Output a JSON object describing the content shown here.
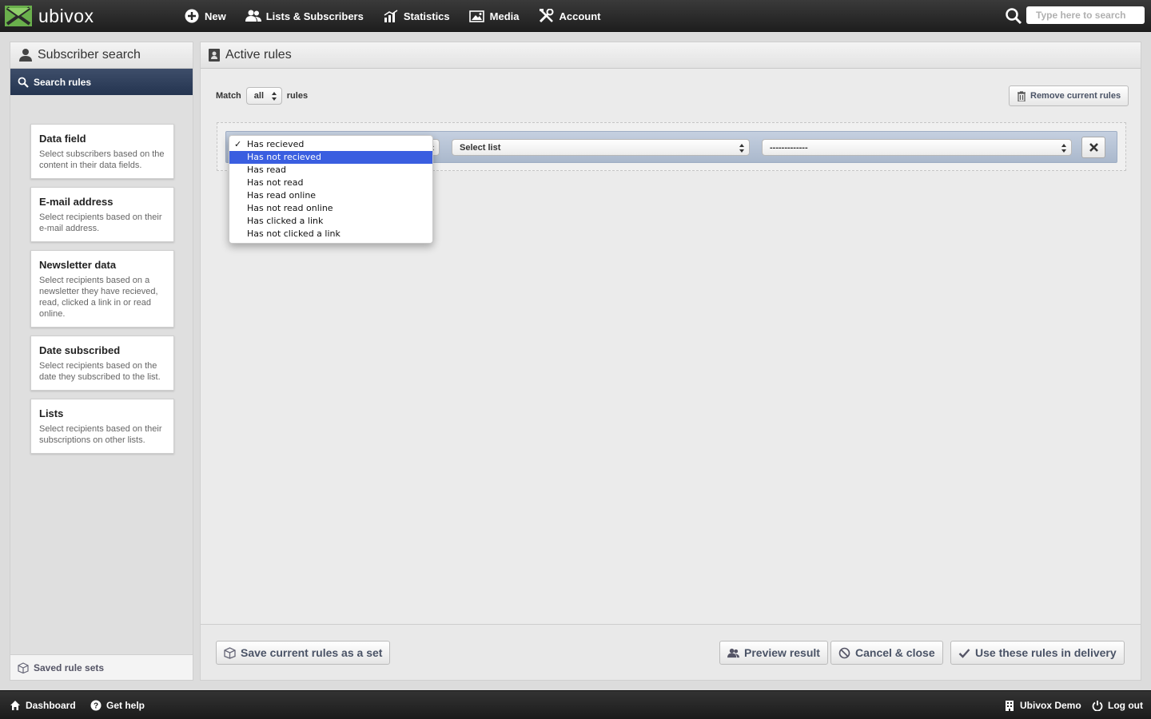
{
  "app": {
    "name": "ubivox"
  },
  "colors": {
    "accent_green": "#6ab04c",
    "nav_blue": "#2c3c58",
    "highlight": "#3a5ee0"
  },
  "topnav": {
    "items": [
      {
        "label": "New",
        "icon": "plus-circle-icon"
      },
      {
        "label": "Lists & Subscribers",
        "icon": "users-icon"
      },
      {
        "label": "Statistics",
        "icon": "bar-chart-icon"
      },
      {
        "label": "Media",
        "icon": "image-icon"
      },
      {
        "label": "Account",
        "icon": "tools-icon"
      }
    ],
    "search_placeholder": "Type here to search"
  },
  "sidebar": {
    "title": "Subscriber search",
    "tab": "Search rules",
    "cards": [
      {
        "title": "Data field",
        "desc": "Select subscribers based on the content in their data fields."
      },
      {
        "title": "E-mail address",
        "desc": "Select recipients based on their e-mail address."
      },
      {
        "title": "Newsletter data",
        "desc": "Select recipients based on a newsletter they have recieved, read, clicked a link in or read online."
      },
      {
        "title": "Date subscribed",
        "desc": "Select recipients based on the date they subscribed to the list."
      },
      {
        "title": "Lists",
        "desc": "Select recipients based on their subscriptions on other lists."
      }
    ],
    "footer": "Saved rule sets"
  },
  "main": {
    "title": "Active rules",
    "match_label": "Match",
    "match_value": "all",
    "rules_label": "rules",
    "remove_button": "Remove current rules",
    "rule": {
      "list_select": "Select list",
      "value_select": "-------------"
    },
    "dropdown": {
      "selected": "Has recieved",
      "highlighted": "Has not recieved",
      "options": [
        "Has recieved",
        "Has not recieved",
        "Has read",
        "Has not read",
        "Has read online",
        "Has not read online",
        "Has clicked a link",
        "Has not clicked a link"
      ]
    },
    "footer": {
      "save_set": "Save current rules as a set",
      "preview": "Preview result",
      "cancel": "Cancel & close",
      "use": "Use these rules in delivery"
    }
  },
  "bottombar": {
    "dashboard": "Dashboard",
    "help": "Get help",
    "account": "Ubivox Demo",
    "logout": "Log out"
  }
}
